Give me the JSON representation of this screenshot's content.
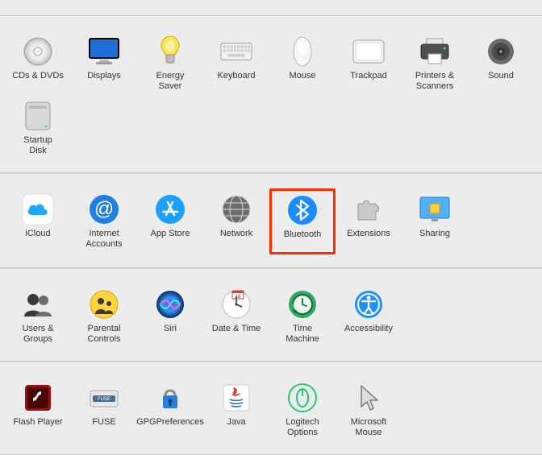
{
  "highlight": "bluetooth",
  "sections": [
    {
      "id": "hardware",
      "items": [
        {
          "id": "cds-dvds",
          "label": "CDs & DVDs"
        },
        {
          "id": "displays",
          "label": "Displays"
        },
        {
          "id": "energy-saver",
          "label": "Energy\nSaver"
        },
        {
          "id": "keyboard",
          "label": "Keyboard"
        },
        {
          "id": "mouse",
          "label": "Mouse"
        },
        {
          "id": "trackpad",
          "label": "Trackpad"
        },
        {
          "id": "printers-scanners",
          "label": "Printers &\nScanners"
        },
        {
          "id": "sound",
          "label": "Sound"
        },
        {
          "id": "startup-disk",
          "label": "Startup\nDisk"
        }
      ]
    },
    {
      "id": "internet",
      "items": [
        {
          "id": "icloud",
          "label": "iCloud"
        },
        {
          "id": "internet-accounts",
          "label": "Internet\nAccounts"
        },
        {
          "id": "app-store",
          "label": "App Store"
        },
        {
          "id": "network",
          "label": "Network"
        },
        {
          "id": "bluetooth",
          "label": "Bluetooth"
        },
        {
          "id": "extensions",
          "label": "Extensions"
        },
        {
          "id": "sharing",
          "label": "Sharing"
        }
      ]
    },
    {
      "id": "system",
      "items": [
        {
          "id": "users-groups",
          "label": "Users &\nGroups"
        },
        {
          "id": "parental-controls",
          "label": "Parental\nControls"
        },
        {
          "id": "siri",
          "label": "Siri"
        },
        {
          "id": "date-time",
          "label": "Date & Time"
        },
        {
          "id": "time-machine",
          "label": "Time\nMachine"
        },
        {
          "id": "accessibility",
          "label": "Accessibility"
        }
      ]
    },
    {
      "id": "thirdparty",
      "items": [
        {
          "id": "flash-player",
          "label": "Flash Player"
        },
        {
          "id": "fuse",
          "label": "FUSE"
        },
        {
          "id": "gpg-preferences",
          "label": "GPGPreferences"
        },
        {
          "id": "java",
          "label": "Java"
        },
        {
          "id": "logitech-options",
          "label": "Logitech Options"
        },
        {
          "id": "microsoft-mouse",
          "label": "Microsoft\nMouse"
        }
      ]
    }
  ]
}
